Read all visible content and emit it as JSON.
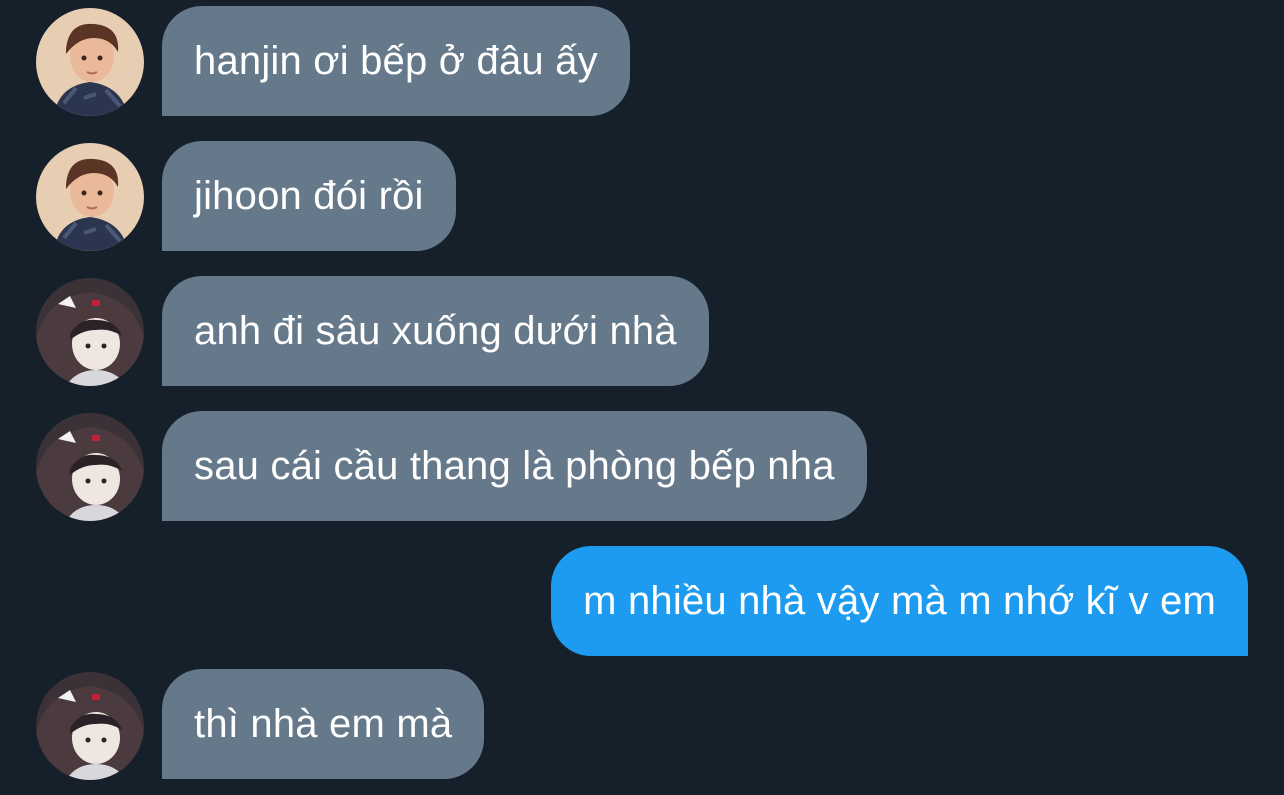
{
  "colors": {
    "background": "#16202b",
    "incoming_bubble": "#66798a",
    "outgoing_bubble": "#1d9bf0",
    "text": "#ffffff"
  },
  "messages": [
    {
      "sender": "hanjin-avatar",
      "direction": "in",
      "text": "hanjin ơi bếp ở đâu ấy"
    },
    {
      "sender": "hanjin-avatar",
      "direction": "in",
      "text": "jihoon đói rồi"
    },
    {
      "sender": "hood-avatar",
      "direction": "in",
      "text": "anh đi sâu xuống dưới nhà"
    },
    {
      "sender": "hood-avatar",
      "direction": "in",
      "text": "sau cái cầu thang là phòng bếp nha"
    },
    {
      "sender": "self",
      "direction": "out",
      "text": "m nhiều nhà vậy mà m nhớ kĩ v em"
    },
    {
      "sender": "hood-avatar",
      "direction": "in",
      "text": "thì nhà em mà"
    }
  ]
}
